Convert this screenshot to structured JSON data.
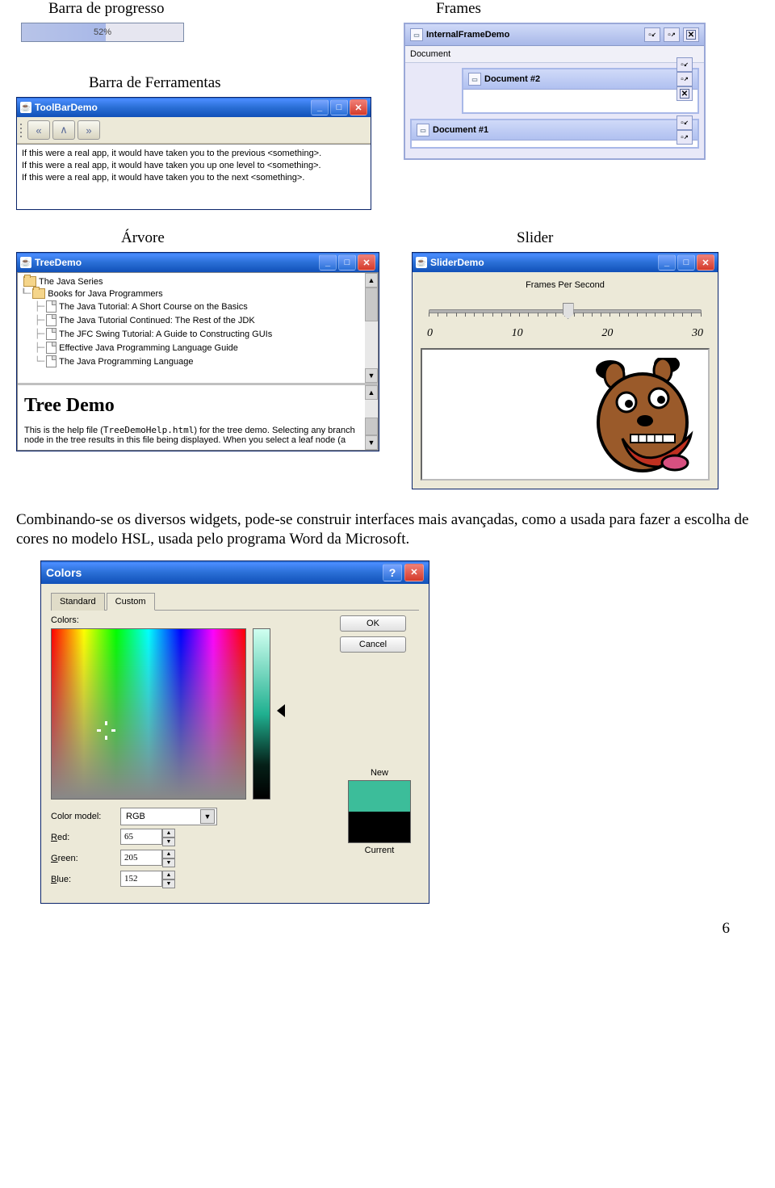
{
  "headings": {
    "progress": "Barra de progresso",
    "frames": "Frames",
    "toolbar": "Barra de Ferramentas",
    "tree": "Árvore",
    "slider": "Slider"
  },
  "progress": {
    "percent": "52%"
  },
  "frames_demo": {
    "title": "InternalFrameDemo",
    "menu": "Document",
    "doc2": "Document #2",
    "doc1": "Document #1"
  },
  "toolbar_demo": {
    "title": "ToolBarDemo",
    "line1": "If this were a real app, it would have taken you to the previous <something>.",
    "line2": "If this were a real app, it would have taken you up one level to <something>.",
    "line3": "If this were a real app, it would have taken you to the next <something>."
  },
  "tree_demo": {
    "title": "TreeDemo",
    "root": "The Java Series",
    "folder": "Books for Java Programmers",
    "item1": "The Java Tutorial: A Short Course on the Basics",
    "item2": "The Java Tutorial Continued: The Rest of the JDK",
    "item3": "The JFC Swing Tutorial: A Guide to Constructing GUIs",
    "item4": "Effective Java Programming Language Guide",
    "item5": "The Java Programming Language",
    "help_title": "Tree Demo",
    "help_p1a": "This is the help file (",
    "help_file": "TreeDemoHelp.html",
    "help_p1b": ") for the tree demo. Selecting any branch",
    "help_p2": "node in the tree results in this file being displayed. When you select a leaf node (a"
  },
  "slider_demo": {
    "title": "SliderDemo",
    "label": "Frames Per Second",
    "n0": "0",
    "n10": "10",
    "n20": "20",
    "n30": "30"
  },
  "paragraph": "Combinando-se os diversos widgets, pode-se construir interfaces mais avançadas, como a usada para fazer a escolha de cores no modelo HSL, usada pelo programa Word da Microsoft.",
  "colors": {
    "title": "Colors",
    "tab_standard": "Standard",
    "tab_custom": "Custom",
    "colors_label": "Colors:",
    "ok": "OK",
    "cancel": "Cancel",
    "new": "New",
    "current": "Current",
    "color_model": "Color model:",
    "model_value": "RGB",
    "red": "Red:",
    "green": "Green:",
    "blue": "Blue:",
    "r": "65",
    "g": "205",
    "b": "152"
  },
  "pagenum": "6"
}
